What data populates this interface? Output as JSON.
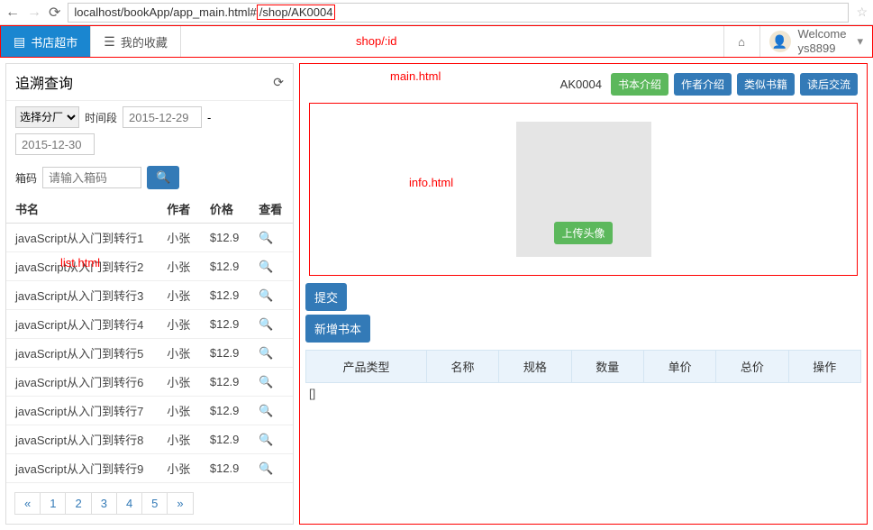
{
  "browser": {
    "url_prefix": "localhost/bookApp/app_main.html#",
    "url_highlight": "/shop/AK0004"
  },
  "annotations": {
    "route": "shop/:id",
    "main": "main.html",
    "info": "info.html",
    "list": "list.html"
  },
  "nav": {
    "tab1": "书店超市",
    "tab2": "我的收藏",
    "welcome": "Welcome",
    "username": "ys8899"
  },
  "left": {
    "title": "追溯查询",
    "filter_label": "选择分厂",
    "time_label": "时间段",
    "date1": "2015-12-29",
    "date2": "2015-12-30",
    "code_label": "箱码",
    "code_ph": "请输入箱码",
    "th_name": "书名",
    "th_author": "作者",
    "th_price": "价格",
    "th_view": "查看",
    "rows": [
      {
        "name": "javaScript从入门到转行1",
        "author": "小张",
        "price": "$12.9"
      },
      {
        "name": "javaScript从入门到转行2",
        "author": "小张",
        "price": "$12.9"
      },
      {
        "name": "javaScript从入门到转行3",
        "author": "小张",
        "price": "$12.9"
      },
      {
        "name": "javaScript从入门到转行4",
        "author": "小张",
        "price": "$12.9"
      },
      {
        "name": "javaScript从入门到转行5",
        "author": "小张",
        "price": "$12.9"
      },
      {
        "name": "javaScript从入门到转行6",
        "author": "小张",
        "price": "$12.9"
      },
      {
        "name": "javaScript从入门到转行7",
        "author": "小张",
        "price": "$12.9"
      },
      {
        "name": "javaScript从入门到转行8",
        "author": "小张",
        "price": "$12.9"
      },
      {
        "name": "javaScript从入门到转行9",
        "author": "小张",
        "price": "$12.9"
      }
    ],
    "pager": [
      "«",
      "1",
      "2",
      "3",
      "4",
      "5",
      "»"
    ]
  },
  "right": {
    "id": "AK0004",
    "btn1": "书本介绍",
    "btn2": "作者介绍",
    "btn3": "类似书籍",
    "btn4": "读后交流",
    "upload": "上传头像",
    "submit": "提交",
    "add": "新增书本",
    "cols": [
      "产品类型",
      "名称",
      "规格",
      "数量",
      "单价",
      "总价",
      "操作"
    ],
    "empty": "[]"
  }
}
